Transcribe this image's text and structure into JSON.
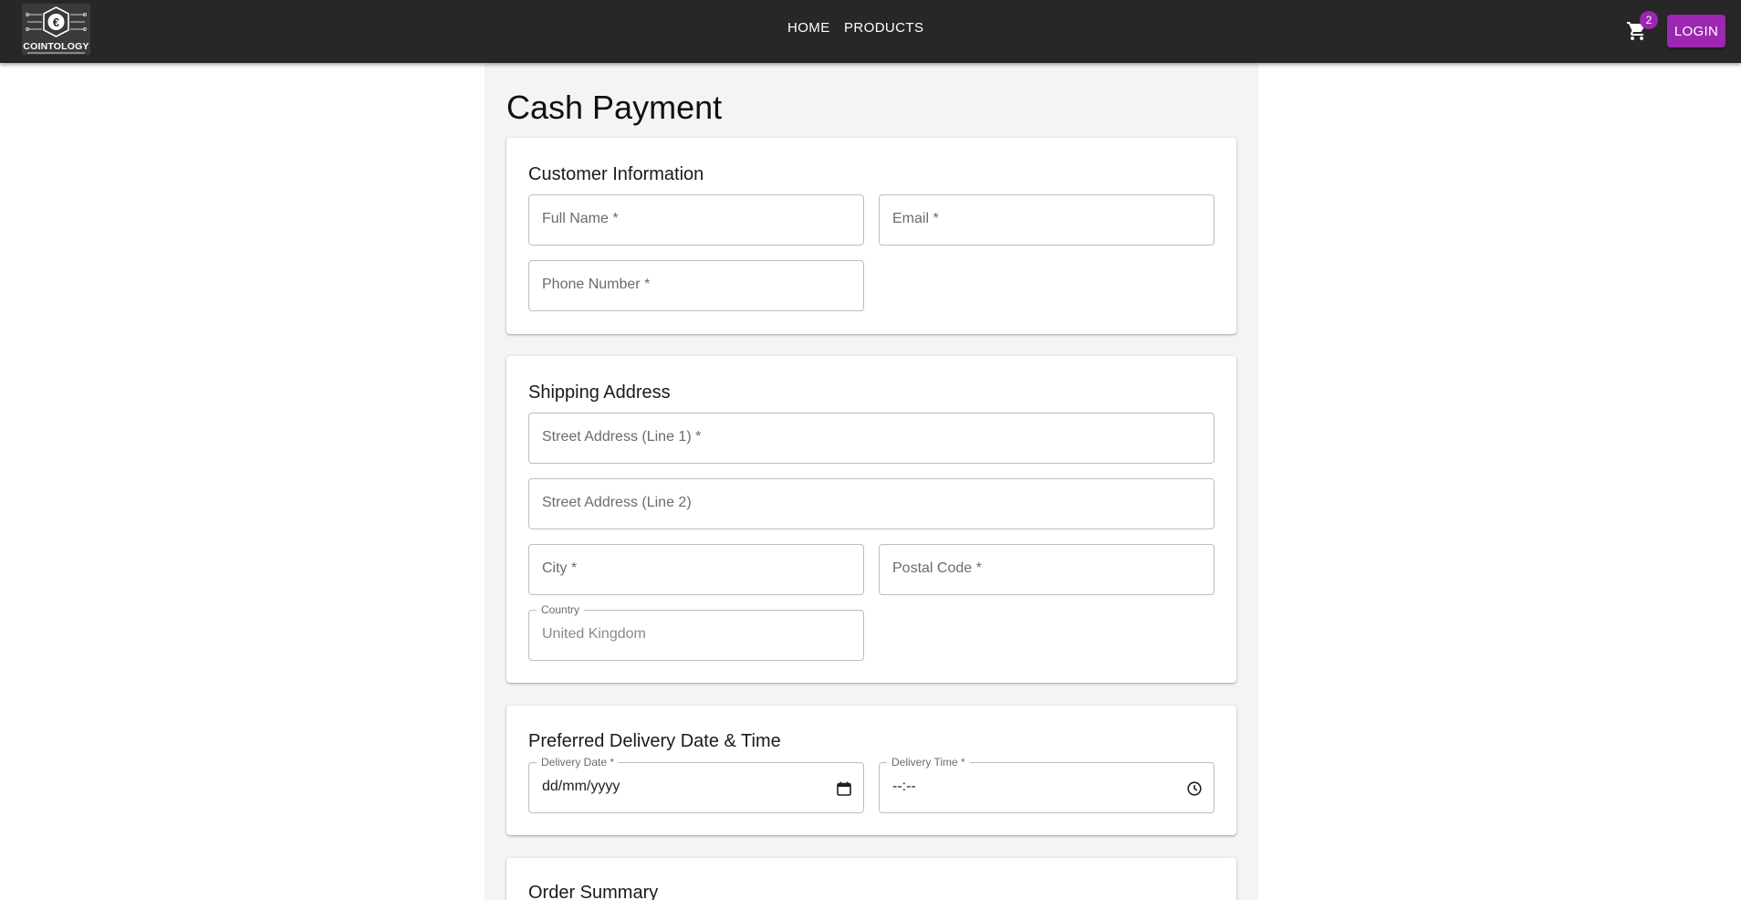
{
  "header": {
    "logo_text": "COINTOLOGY",
    "nav": {
      "home": "HOME",
      "products": "PRODUCTS"
    },
    "cart_count": "2",
    "login_label": "LOGIN",
    "accent_color": "#9c27b0",
    "cart_icon": "shopping-cart-icon"
  },
  "page": {
    "title": "Cash Payment"
  },
  "customer_info": {
    "title": "Customer Information",
    "full_name": "Full Name *",
    "email": "Email *",
    "phone": "Phone Number *"
  },
  "shipping": {
    "title": "Shipping Address",
    "street1": "Street Address (Line 1) *",
    "street2": "Street Address (Line 2)",
    "city": "City *",
    "postal": "Postal Code *",
    "country_label": "Country",
    "country_value": "United Kingdom"
  },
  "delivery": {
    "title": "Preferred Delivery Date & Time",
    "date_label": "Delivery Date *",
    "date_value": "dd/mm/yyyy",
    "time_label": "Delivery Time *",
    "time_value": "--:--",
    "date_icon": "calendar-icon",
    "time_icon": "clock-icon"
  },
  "summary": {
    "title": "Order Summary"
  }
}
